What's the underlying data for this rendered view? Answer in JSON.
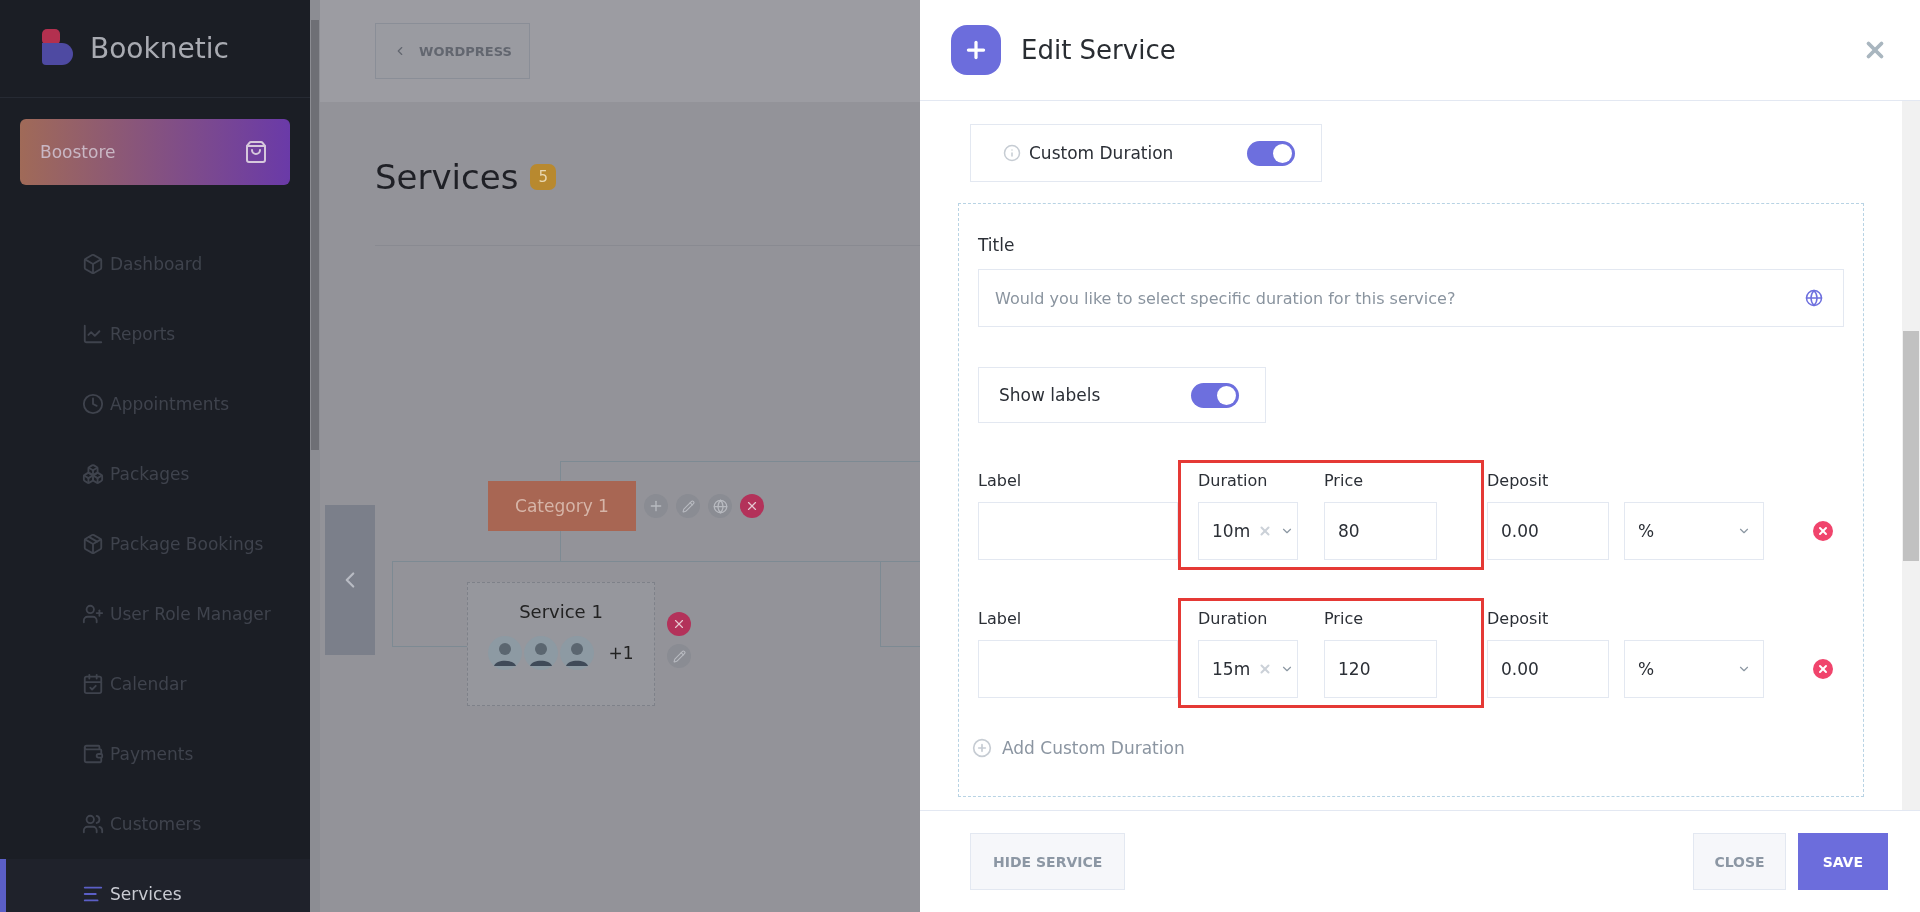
{
  "sidebar": {
    "brand": "Booknetic",
    "store": {
      "label": "Boostore"
    },
    "items": [
      {
        "label": "Dashboard",
        "selected": false
      },
      {
        "label": "Reports",
        "selected": false
      },
      {
        "label": "Appointments",
        "selected": false
      },
      {
        "label": "Packages",
        "selected": false
      },
      {
        "label": "Package Bookings",
        "selected": false
      },
      {
        "label": "User Role Manager",
        "selected": false
      },
      {
        "label": "Calendar",
        "selected": false
      },
      {
        "label": "Payments",
        "selected": false
      },
      {
        "label": "Customers",
        "selected": false
      },
      {
        "label": "Services",
        "selected": true
      }
    ]
  },
  "topbar": {
    "back_button": "WORDPRESS"
  },
  "page": {
    "title": "Services",
    "count": "5"
  },
  "tree": {
    "category": {
      "label": "Category 1"
    },
    "service": {
      "title": "Service 1",
      "more_staff": "+1"
    }
  },
  "panel": {
    "title": "Edit Service",
    "custom_duration": {
      "label": "Custom Duration",
      "on": true
    },
    "title_field": {
      "label": "Title",
      "placeholder": "Would you like to select specific duration for this service?"
    },
    "show_labels": {
      "label": "Show labels",
      "on": true
    },
    "durations": [
      {
        "label_header": "Label",
        "duration_header": "Duration",
        "price_header": "Price",
        "deposit_header": "Deposit",
        "duration": "10m",
        "price": "80",
        "deposit": "0.00",
        "deposit_type": "%",
        "highlighted": true
      },
      {
        "label_header": "Label",
        "duration_header": "Duration",
        "price_header": "Price",
        "deposit_header": "Deposit",
        "duration": "15m",
        "price": "120",
        "deposit": "0.00",
        "deposit_type": "%",
        "highlighted": true
      }
    ],
    "add_button": "Add Custom Duration",
    "footer": {
      "hide": "HIDE SERVICE",
      "close": "CLOSE",
      "save": "SAVE"
    }
  }
}
